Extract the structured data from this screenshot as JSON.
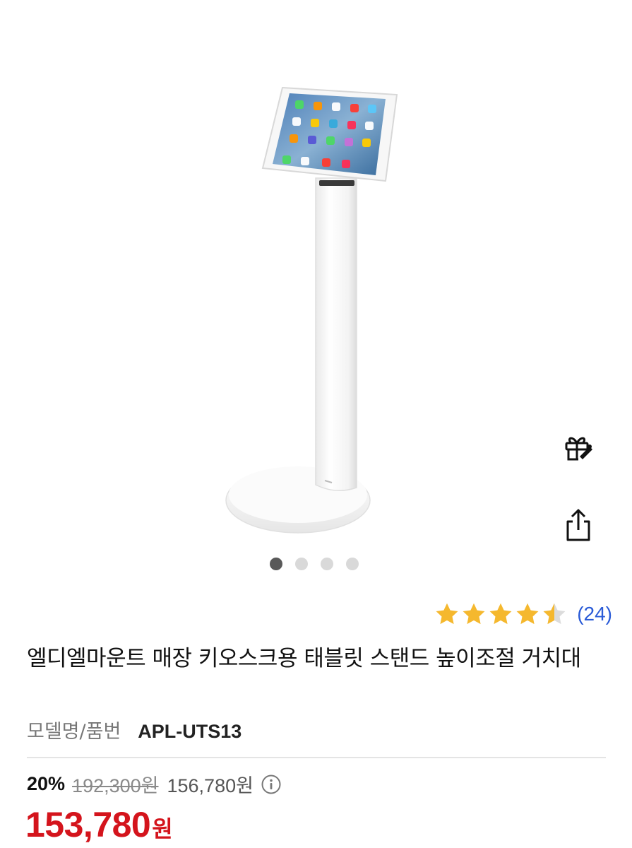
{
  "gallery": {
    "total_images": 4,
    "active_index": 0
  },
  "actions": {
    "gift_icon": "gift-icon",
    "share_icon": "share-icon"
  },
  "rating": {
    "stars": 4.5,
    "max_stars": 5,
    "review_count": "(24)",
    "star_color": "#f5b82e",
    "star_empty_color": "#dcdcdc"
  },
  "product": {
    "title": "엘디엘마운트 매장 키오스크용 태블릿 스탠드 높이조절 거치대",
    "model_label": "모델명/품번",
    "model_value": "APL-UTS13"
  },
  "price": {
    "discount_rate": "20%",
    "original_price": "192,300원",
    "sale_price": "156,780원",
    "final_price": "153,780",
    "final_unit": "원",
    "accent_color": "#d4141c"
  }
}
